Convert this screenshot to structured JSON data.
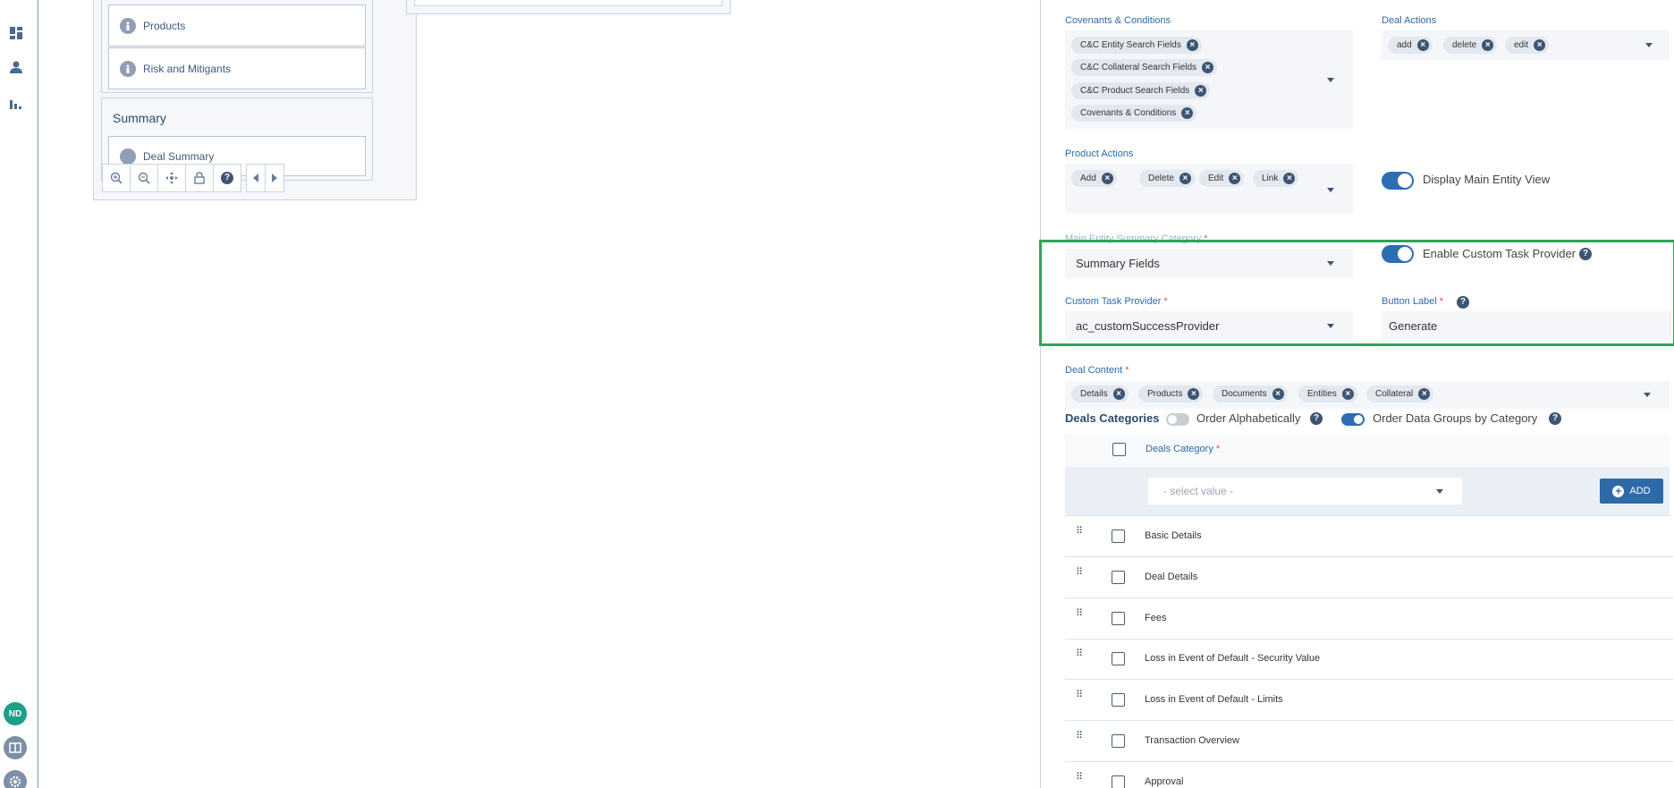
{
  "canvas": {
    "nodes": [
      {
        "label": "Products"
      },
      {
        "label": "Risk and Mitigants"
      }
    ],
    "summary_group_title": "Summary",
    "summary_node_label": "Deal Summary"
  },
  "rail": {
    "avatar_initials": "ND"
  },
  "panel": {
    "covenants": {
      "label": "Covenants & Conditions",
      "chips": [
        "C&C Entity Search Fields",
        "C&C Collateral Search Fields",
        "C&C Product Search Fields",
        "Covenants & Conditions"
      ]
    },
    "deal_actions": {
      "label": "Deal Actions",
      "chips": [
        "add",
        "delete",
        "edit"
      ]
    },
    "product_actions": {
      "label": "Product Actions",
      "chips": [
        "Add",
        "Delete",
        "Edit",
        "Link"
      ]
    },
    "display_main_entity_view": "Display Main Entity View",
    "main_entity_summary_category": {
      "label": "Main Entity Summary Category",
      "value": "Summary Fields"
    },
    "enable_custom_task_provider": "Enable Custom Task Provider",
    "custom_task_provider": {
      "label": "Custom Task Provider",
      "value": "ac_customSuccessProvider"
    },
    "button_label": {
      "label": "Button Label",
      "value": "Generate"
    },
    "deal_content": {
      "label": "Deal Content",
      "chips": [
        "Details",
        "Products",
        "Documents",
        "Entities",
        "Collateral"
      ]
    },
    "deals_categories": {
      "title": "Deals Categories",
      "order_alphabetically": "Order Alphabetically",
      "order_data_groups": "Order Data Groups by Category",
      "column_header": "Deals Category",
      "select_placeholder": "- select value -",
      "add_label": "ADD",
      "rows": [
        "Basic Details",
        "Deal Details",
        "Fees",
        "Loss in Event of Default - Security Value",
        "Loss in Event of Default - Limits",
        "Transaction Overview",
        "Approval"
      ]
    }
  }
}
